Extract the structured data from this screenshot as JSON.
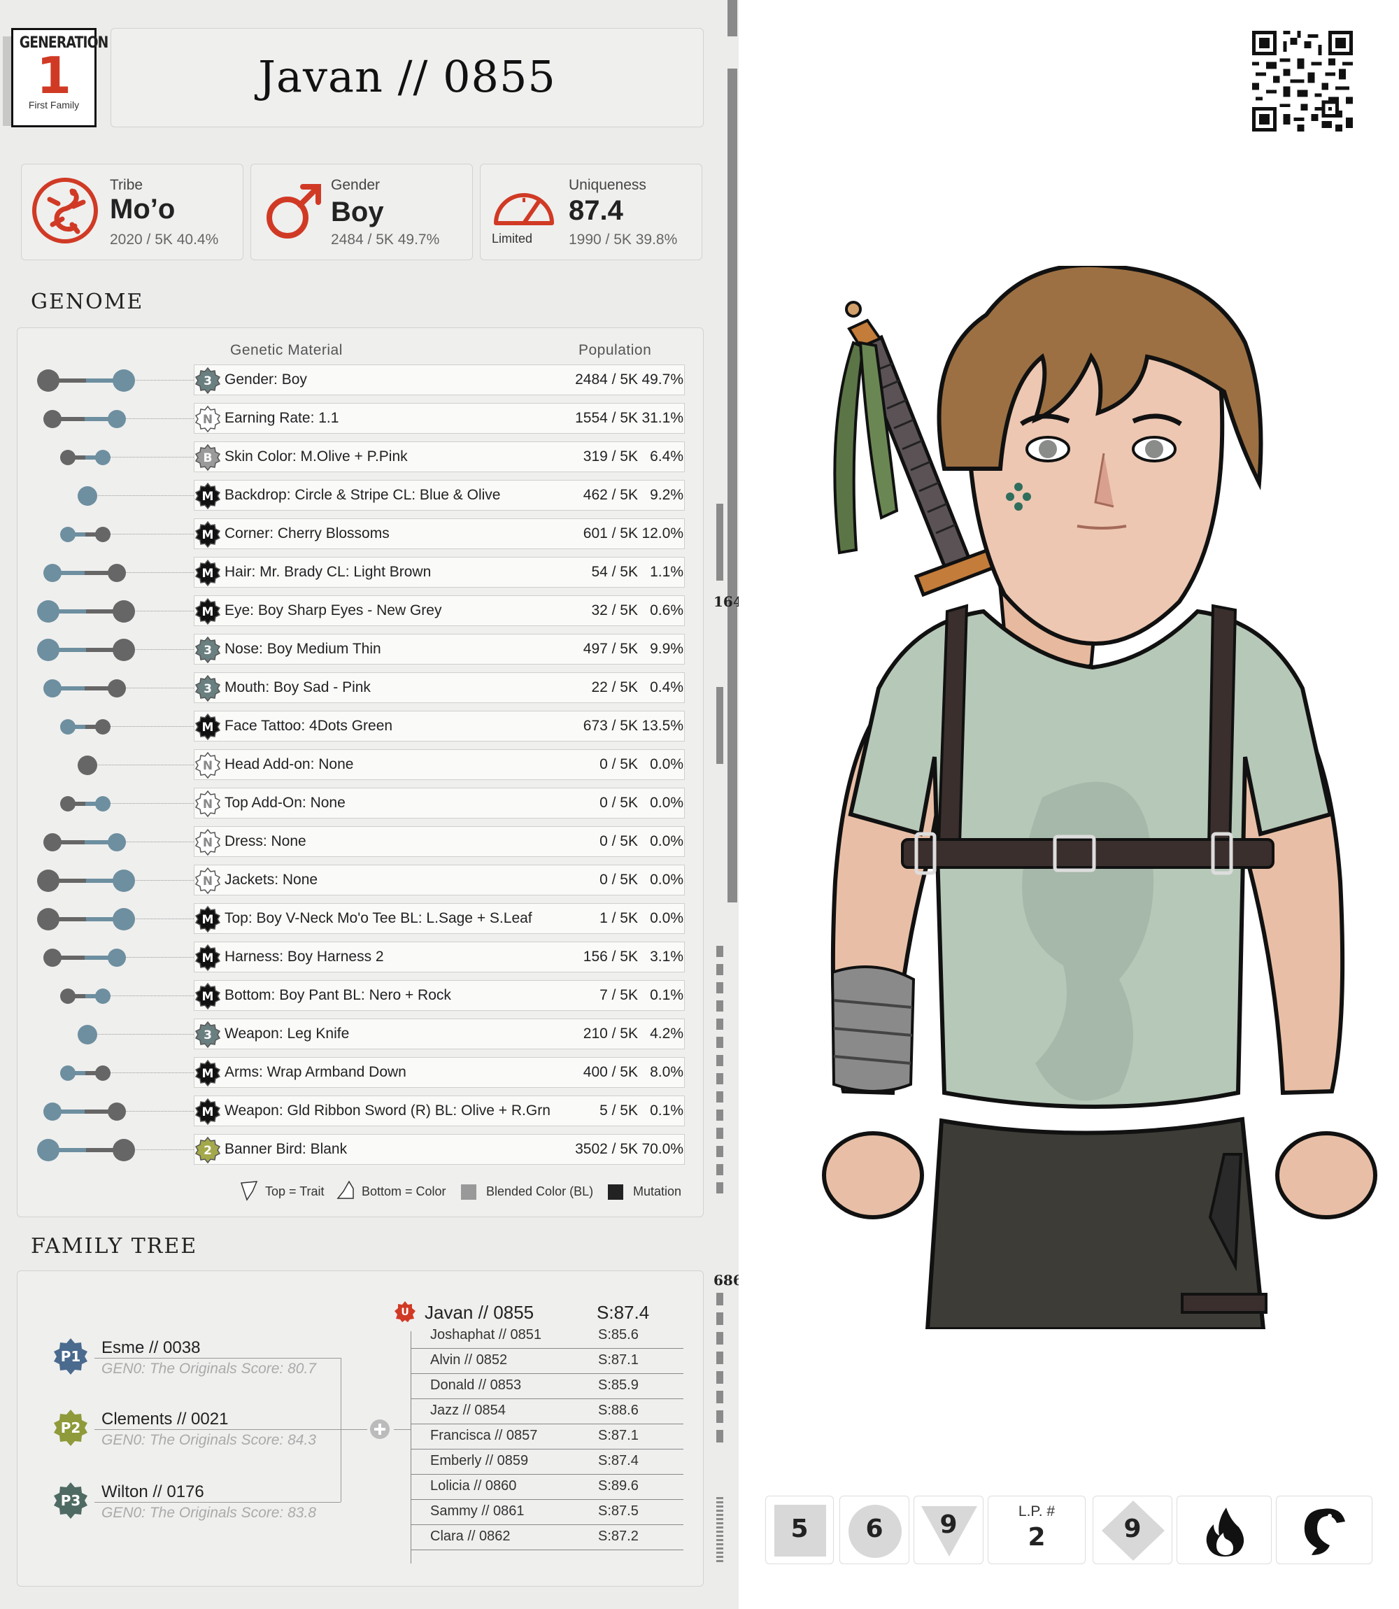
{
  "generation": {
    "label": "GENERATION",
    "number": "1",
    "sub": "First Family"
  },
  "title": "Javan  //  0855",
  "stats": {
    "tribe": {
      "label": "Tribe",
      "value": "Mo’o",
      "sub": "2020 / 5K  40.4%"
    },
    "gender": {
      "label": "Gender",
      "value": "Boy",
      "sub": "2484 / 5K  49.7%"
    },
    "uniqueness": {
      "label": "Uniqueness",
      "value": "87.4",
      "badge": "Limited",
      "sub": "1990 / 5K  39.8%"
    }
  },
  "genome": {
    "title": "GENOME",
    "col_material": "Genetic Material",
    "col_population": "Population",
    "rows": [
      {
        "icon": "3",
        "label": "Gender: Boy",
        "count": "2484 / 5K",
        "pct": "49.7%"
      },
      {
        "icon": "N",
        "label": "Earning Rate: 1.1",
        "count": "1554 / 5K",
        "pct": "31.1%"
      },
      {
        "icon": "B",
        "label": "Skin Color: M.Olive + P.Pink",
        "count": "319 / 5K",
        "pct": "6.4%"
      },
      {
        "icon": "M",
        "label": "Backdrop: Circle & Stripe CL: Blue & Olive",
        "count": "462 / 5K",
        "pct": "9.2%"
      },
      {
        "icon": "M",
        "label": "Corner: Cherry Blossoms",
        "count": "601 / 5K",
        "pct": "12.0%"
      },
      {
        "icon": "M",
        "label": "Hair: Mr. Brady CL: Light Brown",
        "count": "54 / 5K",
        "pct": "1.1%"
      },
      {
        "icon": "M",
        "label": "Eye: Boy Sharp Eyes - New Grey",
        "count": "32 / 5K",
        "pct": "0.6%"
      },
      {
        "icon": "3",
        "label": "Nose: Boy Medium Thin",
        "count": "497 / 5K",
        "pct": "9.9%"
      },
      {
        "icon": "3",
        "label": "Mouth: Boy Sad - Pink",
        "count": "22 / 5K",
        "pct": "0.4%"
      },
      {
        "icon": "M",
        "label": "Face Tattoo: 4Dots Green",
        "count": "673 / 5K",
        "pct": "13.5%"
      },
      {
        "icon": "N",
        "label": "Head Add-on:  None",
        "count": "0 / 5K",
        "pct": "0.0%"
      },
      {
        "icon": "N",
        "label": "Top Add-On:  None",
        "count": "0 / 5K",
        "pct": "0.0%"
      },
      {
        "icon": "N",
        "label": "Dress: None",
        "count": "0 / 5K",
        "pct": "0.0%"
      },
      {
        "icon": "N",
        "label": "Jackets: None",
        "count": "0 / 5K",
        "pct": "0.0%"
      },
      {
        "icon": "M",
        "label": "Top: Boy V-Neck Mo'o Tee BL: L.Sage + S.Leaf",
        "count": "1 / 5K",
        "pct": "0.0%"
      },
      {
        "icon": "M",
        "label": "Harness: Boy Harness 2",
        "count": "156 / 5K",
        "pct": "3.1%"
      },
      {
        "icon": "M",
        "label": "Bottom: Boy Pant BL: Nero + Rock",
        "count": "7 / 5K",
        "pct": "0.1%"
      },
      {
        "icon": "3",
        "label": "Weapon: Leg Knife",
        "count": "210 / 5K",
        "pct": "4.2%"
      },
      {
        "icon": "M",
        "label": "Arms: Wrap Armband Down",
        "count": "400 / 5K",
        "pct": "8.0%"
      },
      {
        "icon": "M",
        "label": "Weapon: Gld Ribbon Sword (R) BL: Olive + R.Grn",
        "count": "5 / 5K",
        "pct": "0.1%"
      },
      {
        "icon": "2",
        "label": "Banner Bird:  Blank",
        "count": "3502 / 5K",
        "pct": "70.0%"
      }
    ],
    "legend": {
      "trait": "Top = Trait",
      "color": "Bottom = Color",
      "blended": "Blended Color (BL)",
      "mutation": "Mutation"
    }
  },
  "family": {
    "title": "FAMILY TREE",
    "parents": [
      {
        "badge": "P1",
        "name": "Esme  //  0038",
        "sub": "GEN0: The Originals Score: 80.7",
        "color": "#4a6a8e"
      },
      {
        "badge": "P2",
        "name": "Clements  //  0021",
        "sub": "GEN0: The Originals Score: 84.3",
        "color": "#8f9a3a"
      },
      {
        "badge": "P3",
        "name": "Wilton  //  0176",
        "sub": "GEN0: The Originals Score: 83.8",
        "color": "#4f6a62"
      }
    ],
    "self": {
      "badge": "U",
      "name": "Javan // 0855",
      "score": "S:87.4"
    },
    "siblings": [
      {
        "name": "Joshaphat  //  0851",
        "score": "S:85.6"
      },
      {
        "name": "Alvin  //  0852",
        "score": "S:87.1"
      },
      {
        "name": "Donald  //  0853",
        "score": "S:85.9"
      },
      {
        "name": "Jazz  //  0854",
        "score": "S:88.6"
      },
      {
        "name": "Francisca  //  0857",
        "score": "S:87.1"
      },
      {
        "name": "Emberly  //  0859",
        "score": "S:87.4"
      },
      {
        "name": "Lolicia  //  0860",
        "score": "S:89.6"
      },
      {
        "name": "Sammy  //  0861",
        "score": "S:87.5"
      },
      {
        "name": "Clara  //  0862",
        "score": "S:87.2"
      }
    ]
  },
  "sidebar": {
    "mark1": "164",
    "mark2": "686"
  },
  "cards": [
    {
      "value": "5"
    },
    {
      "value": "6"
    },
    {
      "value": "9"
    },
    {
      "label": "L.P. #",
      "value": "2"
    },
    {
      "value": "9"
    },
    {
      "icon": "flame-icon"
    },
    {
      "icon": "bird-icon"
    }
  ],
  "colors": {
    "accent_red": "#d03a25",
    "blue_dot": "#6d8fa0",
    "grey_dot": "#666666"
  }
}
